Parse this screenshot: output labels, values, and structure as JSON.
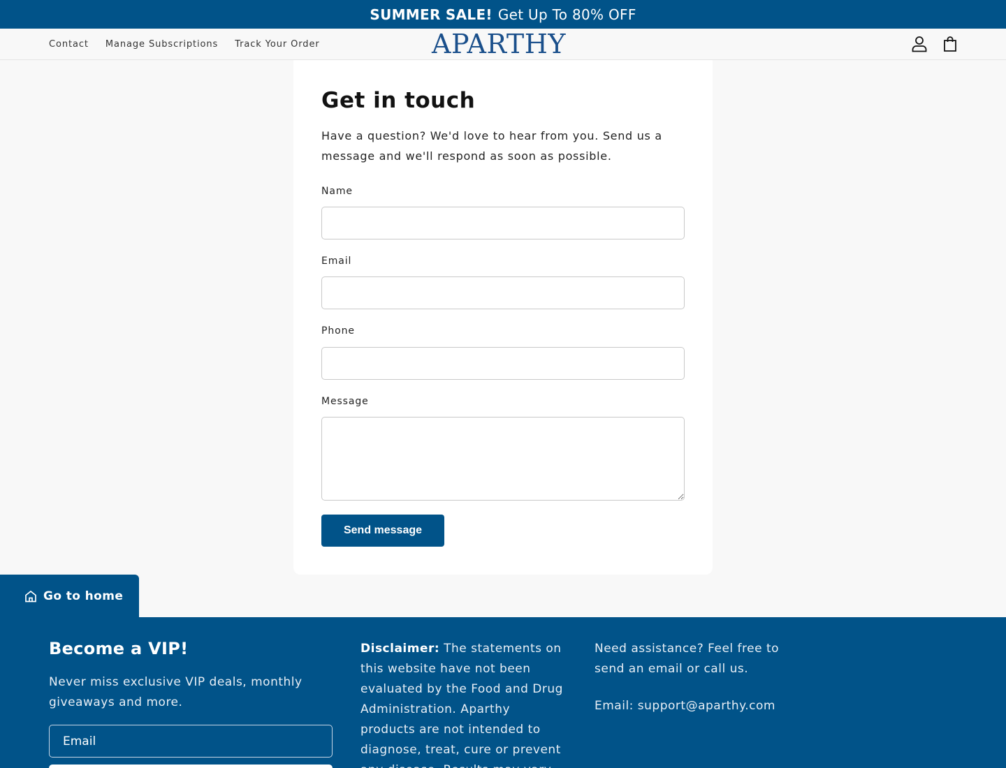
{
  "announcement": {
    "bold": "SUMMER SALE!",
    "text": "Get Up To 80% OFF"
  },
  "header": {
    "nav": [
      "Contact",
      "Manage Subscriptions",
      "Track Your Order"
    ],
    "logo": "APARTHY",
    "icons": [
      "account-icon",
      "cart-icon"
    ]
  },
  "contact_form": {
    "title": "Get in touch",
    "intro": "Have a question? We'd love to hear from you. Send us a message and we'll respond as soon as possible.",
    "fields": {
      "name_label": "Name",
      "email_label": "Email",
      "phone_label": "Phone",
      "message_label": "Message"
    },
    "submit_label": "Send message"
  },
  "go_home": {
    "label": "Go to home",
    "icon": "home-icon"
  },
  "footer": {
    "vip_title": "Become a VIP!",
    "vip_text": "Never miss exclusive VIP deals, monthly giveaways and more.",
    "vip_email_placeholder": "Email",
    "disclaimer_bold": "Disclaimer:",
    "disclaimer_text": "The statements on this website have not been evaluated by the Food and Drug Administration. Aparthy products are not intended to diagnose, treat, cure or prevent any disease. Results may vary.",
    "assist_text": "Need assistance? Feel free to send an email or call us.",
    "assist_email": "Email: support@aparthy.com"
  },
  "colors": {
    "brand": "#015389",
    "logo": "#1a4f8b"
  }
}
